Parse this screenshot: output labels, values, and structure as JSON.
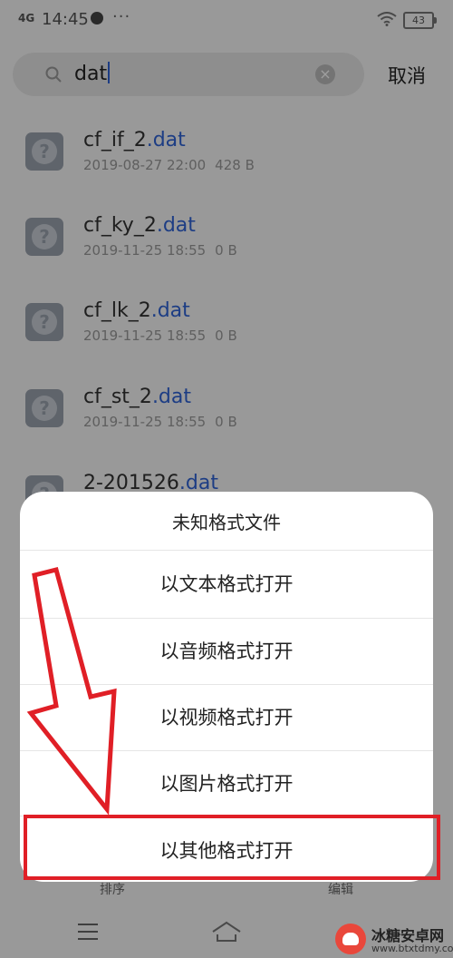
{
  "status_bar": {
    "network": "4G",
    "time": "14:45",
    "more": "···",
    "battery": "43"
  },
  "search": {
    "query": "dat",
    "cancel_label": "取消"
  },
  "files": [
    {
      "base": "cf_if_2",
      "ext": ".dat",
      "date": "2019-08-27 22:00",
      "size": "428 B"
    },
    {
      "base": "cf_ky_2",
      "ext": ".dat",
      "date": "2019-11-25 18:55",
      "size": "0 B"
    },
    {
      "base": "cf_lk_2",
      "ext": ".dat",
      "date": "2019-11-25 18:55",
      "size": "0 B"
    },
    {
      "base": "cf_st_2",
      "ext": ".dat",
      "date": "2019-11-25 18:55",
      "size": "0 B"
    },
    {
      "base": "2-201526",
      "ext": ".dat",
      "date": "",
      "size": ""
    }
  ],
  "bottom_bar": {
    "sort_label": "排序",
    "edit_label": "编辑"
  },
  "sheet": {
    "title": "未知格式文件",
    "options": [
      "以文本格式打开",
      "以音频格式打开",
      "以视频格式打开",
      "以图片格式打开",
      "以其他格式打开"
    ]
  },
  "annotation": {
    "highlight_color": "#e01f26"
  },
  "watermark": {
    "name": "冰糖安卓网",
    "url": "www.btxtdmy.com"
  },
  "icons": [
    "search-icon",
    "clear-icon",
    "unknown-file-icon",
    "wifi-icon",
    "battery-icon",
    "menu-icon",
    "home-icon"
  ]
}
